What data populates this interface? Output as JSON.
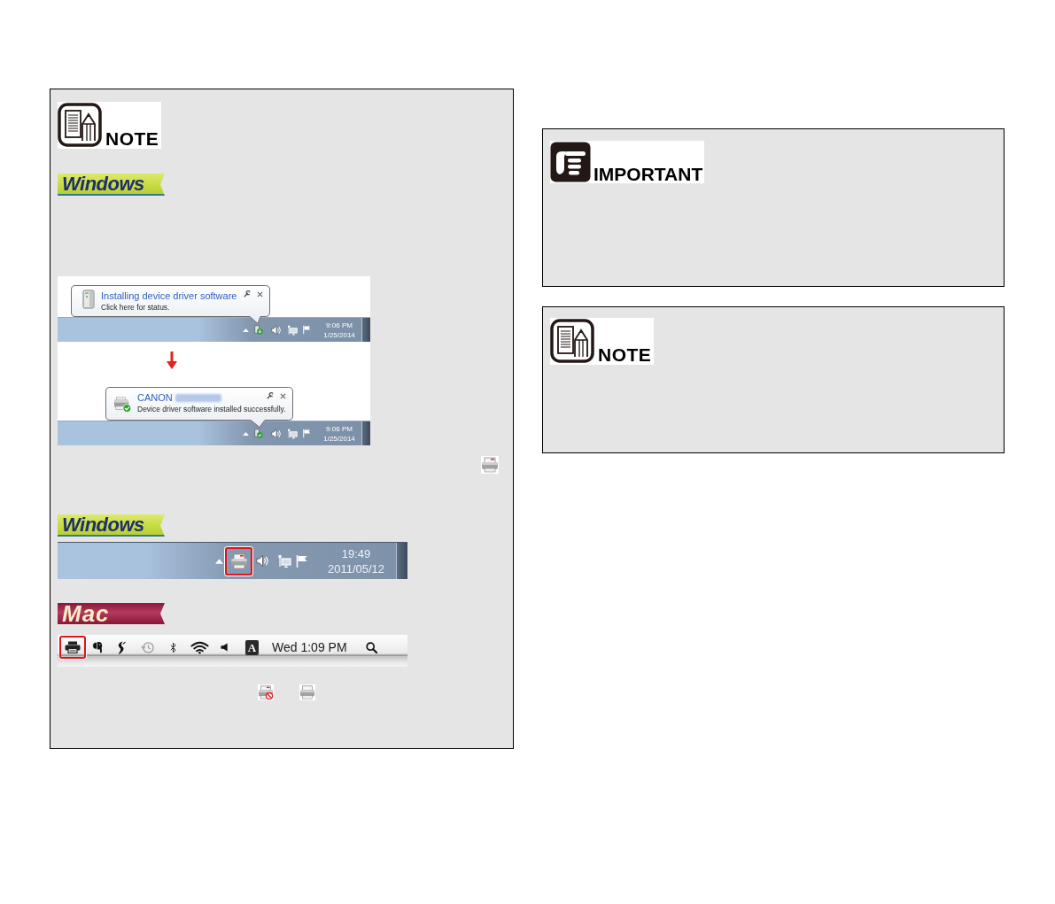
{
  "left_column": {
    "panels": [
      {
        "badge": {
          "kind": "note",
          "label": "NOTE"
        },
        "items": [
          {
            "kind": "windows_banner",
            "label": "Windows"
          },
          {
            "kind": "notification_screenshot",
            "steps": [
              {
                "kind": "installing",
                "title": "Installing device driver software",
                "title_blurred": false,
                "subtitle": "Click here for status.",
                "time": "9:06 PM",
                "date": "1/25/2014"
              },
              {
                "kind": "installed",
                "title": "CANON",
                "title_blurred": true,
                "subtitle": "Device driver software installed successfully.",
                "time": "9:06 PM",
                "date": "1/25/2014"
              }
            ]
          },
          {
            "kind": "scanner_icon"
          },
          {
            "kind": "windows_banner",
            "label": "Windows"
          },
          {
            "kind": "windows_taskbar",
            "scanner_highlighted": true,
            "time": "19:49",
            "date": "2011/05/12"
          },
          {
            "kind": "mac_banner",
            "label": "Mac"
          },
          {
            "kind": "mac_menu_bar",
            "scanner_highlighted": true,
            "input_menu_letter": "A",
            "clock": "Wed 1:09 PM"
          },
          {
            "kind": "status_icons"
          }
        ]
      }
    ]
  },
  "right_column": {
    "panels": [
      {
        "badge": {
          "kind": "important",
          "label": "IMPORTANT"
        }
      },
      {
        "badge": {
          "kind": "note",
          "label": "NOTE"
        }
      }
    ]
  }
}
